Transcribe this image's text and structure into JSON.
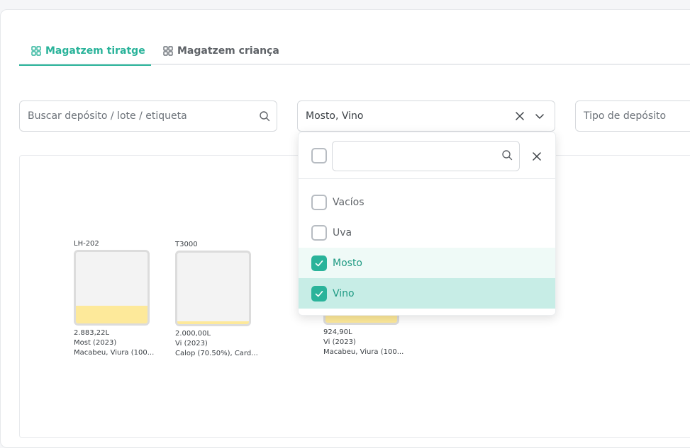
{
  "tabs": [
    {
      "label": "Magatzem tiratge",
      "active": true
    },
    {
      "label": "Magatzem criança",
      "active": false
    }
  ],
  "filters": {
    "search_placeholder": "Buscar depósito / lote / etiqueta",
    "content_value": "Mosto, Vino",
    "type_placeholder": "Tipo de depósito"
  },
  "dropdown": {
    "search_value": "",
    "options": [
      {
        "label": "Vacíos",
        "checked": false
      },
      {
        "label": "Uva",
        "checked": false
      },
      {
        "label": "Mosto",
        "checked": true
      },
      {
        "label": "Vino",
        "checked": true
      }
    ]
  },
  "tanks": [
    {
      "name": "LH-202",
      "volume": "2.883,22L",
      "content": "Most (2023)",
      "varieties": "Macabeu, Viura (100...",
      "fill_fraction": 0.25
    },
    {
      "name": "T3000",
      "volume": "2.000,00L",
      "content": "Vi (2023)",
      "varieties": "Calop (70.50%), Card...",
      "fill_fraction": 0.04
    },
    {
      "name": "",
      "volume": "924,90L",
      "content": "Vi (2023)",
      "varieties": "Macabeu, Viura (100...",
      "fill_fraction": 0.1
    }
  ],
  "colors": {
    "accent": "#2ab39a",
    "fill": "#fde99a"
  }
}
